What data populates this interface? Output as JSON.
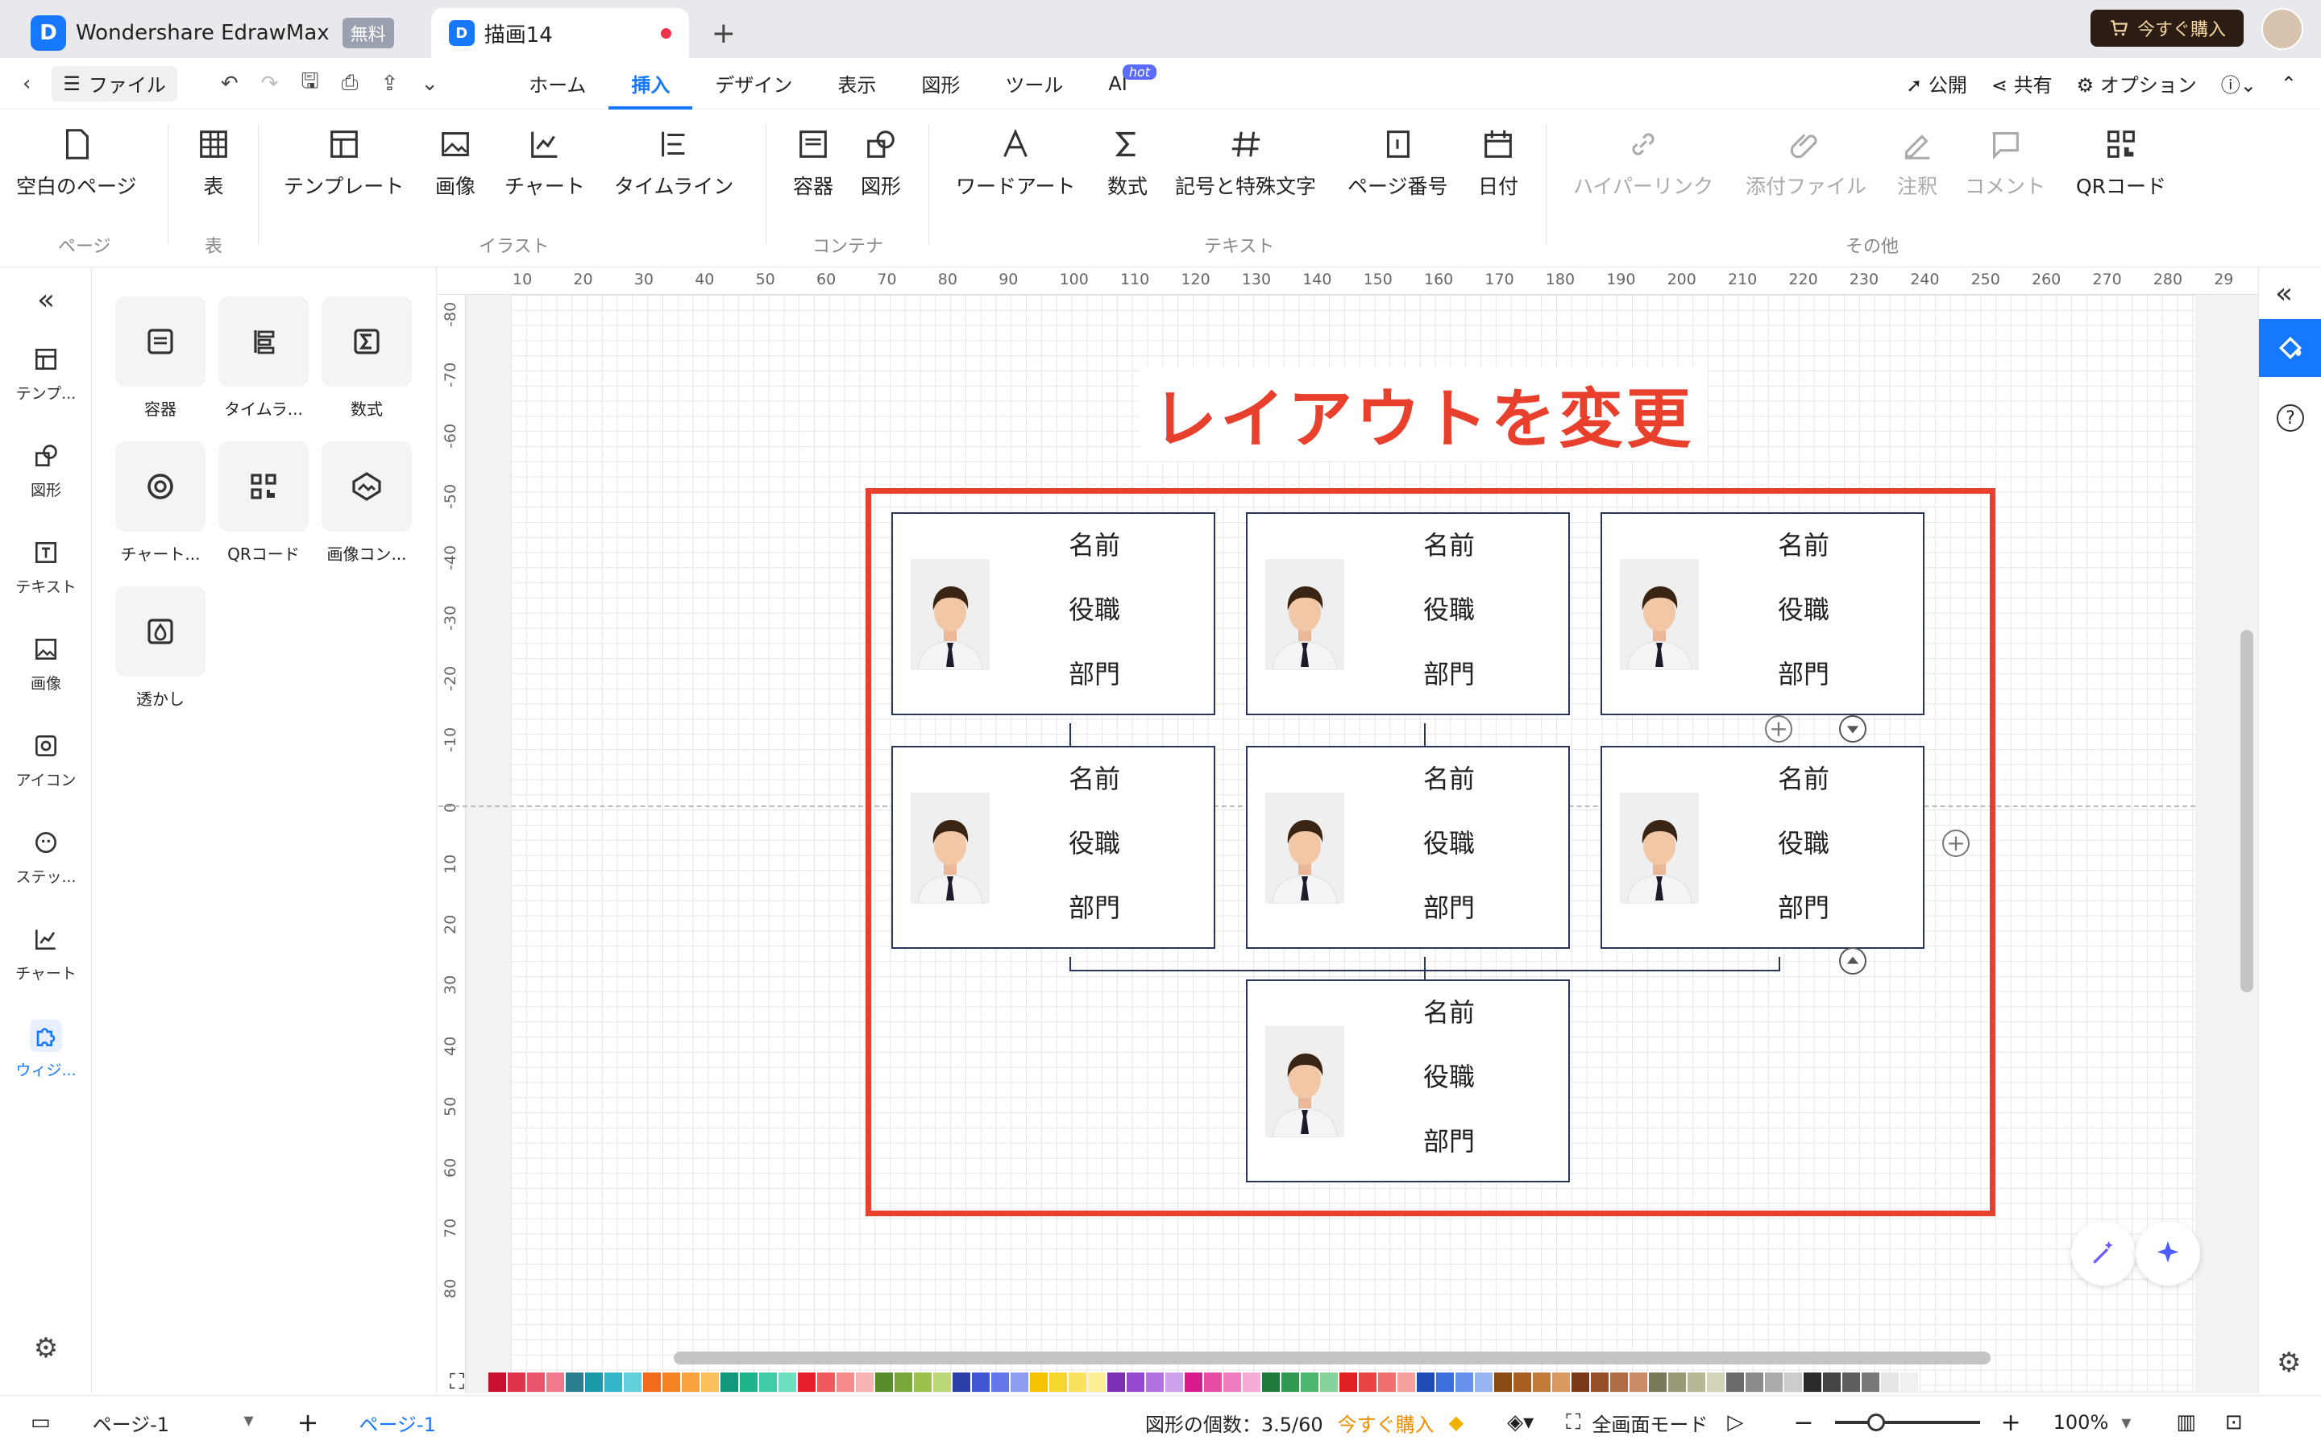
{
  "titlebar": {
    "app_name": "Wondershare EdrawMax",
    "free_badge": "無料",
    "doc_tab": "描画14",
    "buy_now": "今すぐ購入"
  },
  "menubar": {
    "file": "ファイル",
    "tabs": [
      "ホーム",
      "挿入",
      "デザイン",
      "表示",
      "図形",
      "ツール",
      "AI"
    ],
    "active_tab": "挿入",
    "ai_badge": "hot",
    "publish": "公開",
    "share": "共有",
    "options": "オプション"
  },
  "ribbon": {
    "buttons": {
      "blank_page": "空白のページ",
      "table": "表",
      "template": "テンプレート",
      "image": "画像",
      "chart": "チャート",
      "timeline": "タイムライン",
      "container": "容器",
      "shape": "図形",
      "wordart": "ワードアート",
      "formula": "数式",
      "symbols": "記号と特殊文字",
      "page_number": "ページ番号",
      "date": "日付",
      "hyperlink": "ハイパーリンク",
      "attachment": "添付ファイル",
      "note": "注釈",
      "comment": "コメント",
      "qrcode": "QRコード"
    },
    "groups": {
      "page": "ページ",
      "table": "表",
      "illust": "イラスト",
      "container": "コンテナ",
      "text": "テキスト",
      "other": "その他"
    }
  },
  "leftbar": {
    "items": [
      "テンプ...",
      "図形",
      "テキスト",
      "画像",
      "アイコン",
      "ステッ...",
      "チャート",
      "ウィジ..."
    ],
    "active": "ウィジ..."
  },
  "panel": {
    "widgets": [
      "容器",
      "タイムラ...",
      "数式",
      "チャート...",
      "QRコード",
      "画像コン...",
      "透かし"
    ]
  },
  "rulers": {
    "h": [
      "10",
      "20",
      "30",
      "40",
      "50",
      "60",
      "70",
      "80",
      "90",
      "100",
      "110",
      "120",
      "130",
      "140",
      "150",
      "160",
      "170",
      "180",
      "190",
      "200",
      "210",
      "220",
      "230",
      "240",
      "250",
      "260",
      "270",
      "280",
      "29"
    ],
    "v": [
      "-80",
      "-70",
      "-60",
      "-50",
      "-40",
      "-30",
      "-20",
      "-10",
      "0",
      "10",
      "20",
      "30",
      "40",
      "50",
      "60",
      "70",
      "80"
    ]
  },
  "canvas": {
    "heading": "レイアウトを変更",
    "card": {
      "name": "名前",
      "title": "役職",
      "dept": "部門"
    }
  },
  "palette": [
    "#c8102e",
    "#e0314b",
    "#e8566b",
    "#f07a8c",
    "#2b7c8e",
    "#1b9aaa",
    "#33b5c8",
    "#5fd0dc",
    "#f26b1d",
    "#f58220",
    "#f9a23b",
    "#fbbf5b",
    "#11987a",
    "#1fb38c",
    "#3fcba4",
    "#6ee0c2",
    "#e5202a",
    "#f05a5e",
    "#f48a8c",
    "#f8b3b4",
    "#5b8c2a",
    "#78a63a",
    "#9cc14e",
    "#bcd876",
    "#2c3ea8",
    "#3f55d2",
    "#6377e8",
    "#8d9bf0",
    "#f5c400",
    "#f8d52e",
    "#fbe25e",
    "#fdef96",
    "#7a2fb6",
    "#9548d0",
    "#b173e0",
    "#cda2ec",
    "#d91c8c",
    "#e64ba6",
    "#ee7cbf",
    "#f5acd6",
    "#1e7a3c",
    "#2e9a52",
    "#4cb86e",
    "#86d49c",
    "#e02020",
    "#ea4545",
    "#f07070",
    "#f6a0a0",
    "#1f4db6",
    "#3d6fdc",
    "#6891ea",
    "#98b6f2",
    "#8a4a12",
    "#a65f1e",
    "#c07a3a",
    "#d99a62",
    "#7a3a18",
    "#95502a",
    "#b06c44",
    "#c98c68",
    "#7a7a5a",
    "#9a9a78",
    "#b8b896",
    "#d4d4b8",
    "#6b6b6b",
    "#8a8a8a",
    "#aaaaaa",
    "#cccccc",
    "#2a2a2a",
    "#444444",
    "#5e5e5e",
    "#787878",
    "#e6e6e6",
    "#f0f0f0"
  ],
  "status": {
    "page_tab": "ページ-1",
    "active_page": "ページ-1",
    "shape_count": "図形の個数：3.5/60",
    "buy_now": "今すぐ購入",
    "fullscreen": "全画面モード",
    "zoom": "100%"
  }
}
